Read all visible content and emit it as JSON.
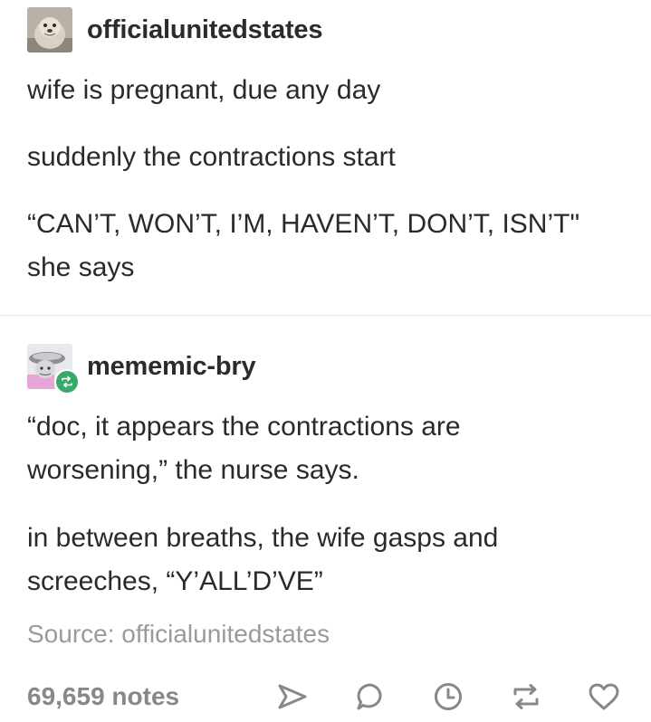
{
  "post": {
    "original_author": "officialunitedstates",
    "original_body": [
      "wife is pregnant, due any day",
      "suddenly the contractions start",
      "“CAN’T, WON’T, I’M, HAVEN’T, DON’T, ISN’T\" she says"
    ],
    "reblogger": "mememic-bry",
    "reblog_body": [
      "“doc, it appears the contractions are worsening,” the nurse says.",
      "in between breaths, the wife gasps and screeches, “Y’ALL’D’VE”"
    ],
    "source_text": "Source: officialunitedstates",
    "notes": "69,659 notes",
    "icons": {
      "original_avatar": "seal-avatar-icon",
      "reblogger_avatar": "figurine-avatar-icon",
      "reblog_badge": "reblog-icon",
      "share": "send-icon",
      "reply": "reply-icon",
      "queue": "clock-icon",
      "reblog": "reblog-icon",
      "like": "heart-icon"
    },
    "colors": {
      "text": "#2a2a2a",
      "muted": "#9a9a9a",
      "reblog_badge": "#3aa76b",
      "divider": "#e6e6e6"
    }
  }
}
